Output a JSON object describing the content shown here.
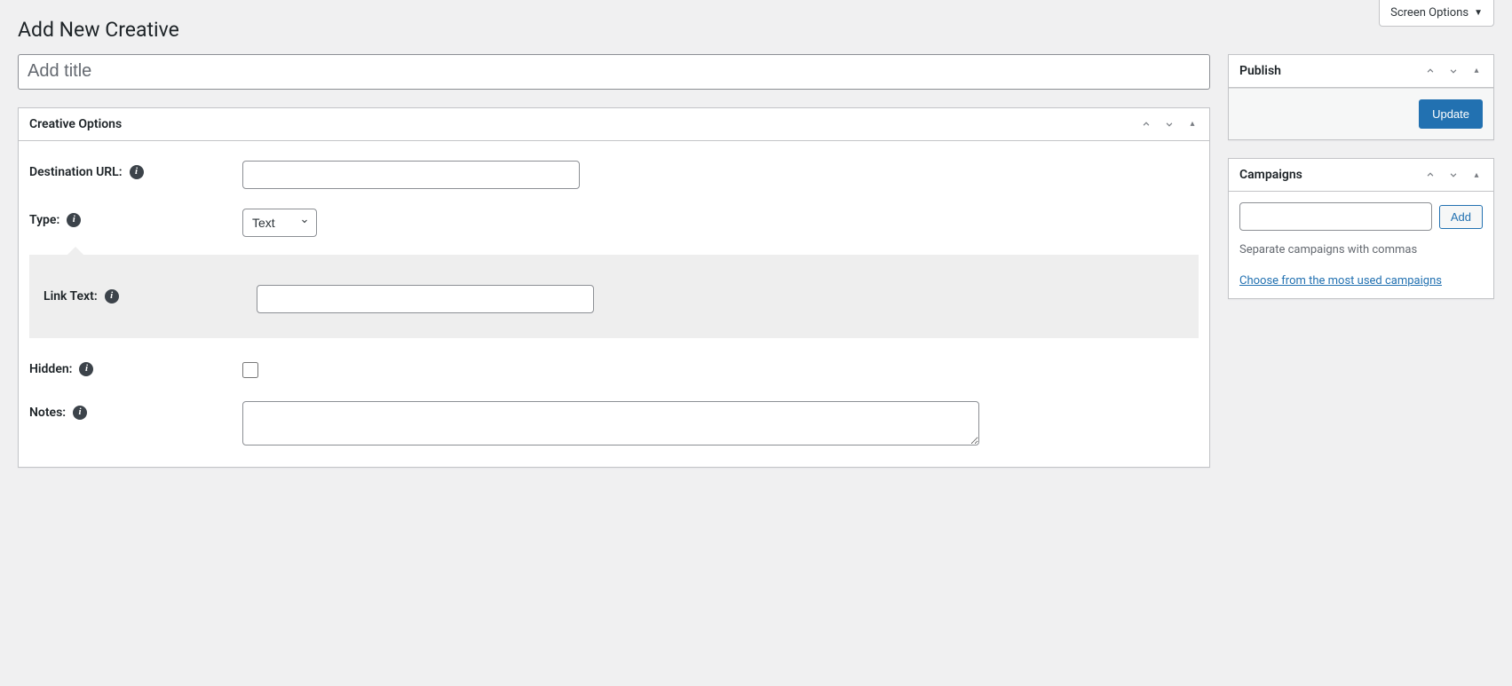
{
  "screenOptions": {
    "label": "Screen Options"
  },
  "page": {
    "title": "Add New Creative"
  },
  "titleField": {
    "placeholder": "Add title",
    "value": ""
  },
  "metabox": {
    "creativeOptions": {
      "title": "Creative Options",
      "fields": {
        "destinationUrl": {
          "label": "Destination URL:",
          "value": ""
        },
        "type": {
          "label": "Type:",
          "selected": "Text"
        },
        "linkText": {
          "label": "Link Text:",
          "value": ""
        },
        "hidden": {
          "label": "Hidden:",
          "checked": false
        },
        "notes": {
          "label": "Notes:",
          "value": ""
        }
      }
    },
    "publish": {
      "title": "Publish",
      "updateButton": "Update"
    },
    "campaigns": {
      "title": "Campaigns",
      "input": "",
      "addButton": "Add",
      "hint": "Separate campaigns with commas",
      "mostUsedLink": "Choose from the most used campaigns"
    }
  }
}
